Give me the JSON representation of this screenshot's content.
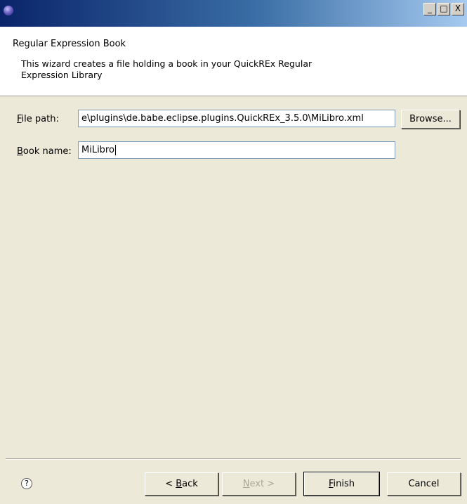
{
  "window": {
    "title": "",
    "controls": {
      "minimize": "_",
      "maximize": "□",
      "close": "X"
    }
  },
  "banner": {
    "title": "Regular Expression Book",
    "message": "This wizard creates a file holding a book in your QuickREx Regular Expression Library"
  },
  "form": {
    "file_path": {
      "label_prefix": "",
      "label_mnemonic": "F",
      "label_rest": "ile path:",
      "value": "e\\plugins\\de.babe.eclipse.plugins.QuickREx_3.5.0\\MiLibro.xml"
    },
    "browse_label": "Browse...",
    "book_name": {
      "label_mnemonic": "B",
      "label_rest": "ook name:",
      "value": "MiLibro"
    }
  },
  "footer": {
    "help_icon": "question-mark-icon",
    "help_glyph": "?",
    "back": {
      "prefix": "< ",
      "mnemonic": "B",
      "rest": "ack"
    },
    "next": {
      "mnemonic": "N",
      "rest": "ext >"
    },
    "finish": {
      "mnemonic": "F",
      "rest": "inish"
    },
    "cancel": "Cancel"
  },
  "colors": {
    "titlebar_start": "#0a246a",
    "titlebar_end": "#a6caf0",
    "dialog_bg": "#ece9d8",
    "disabled_text": "#aca899"
  }
}
